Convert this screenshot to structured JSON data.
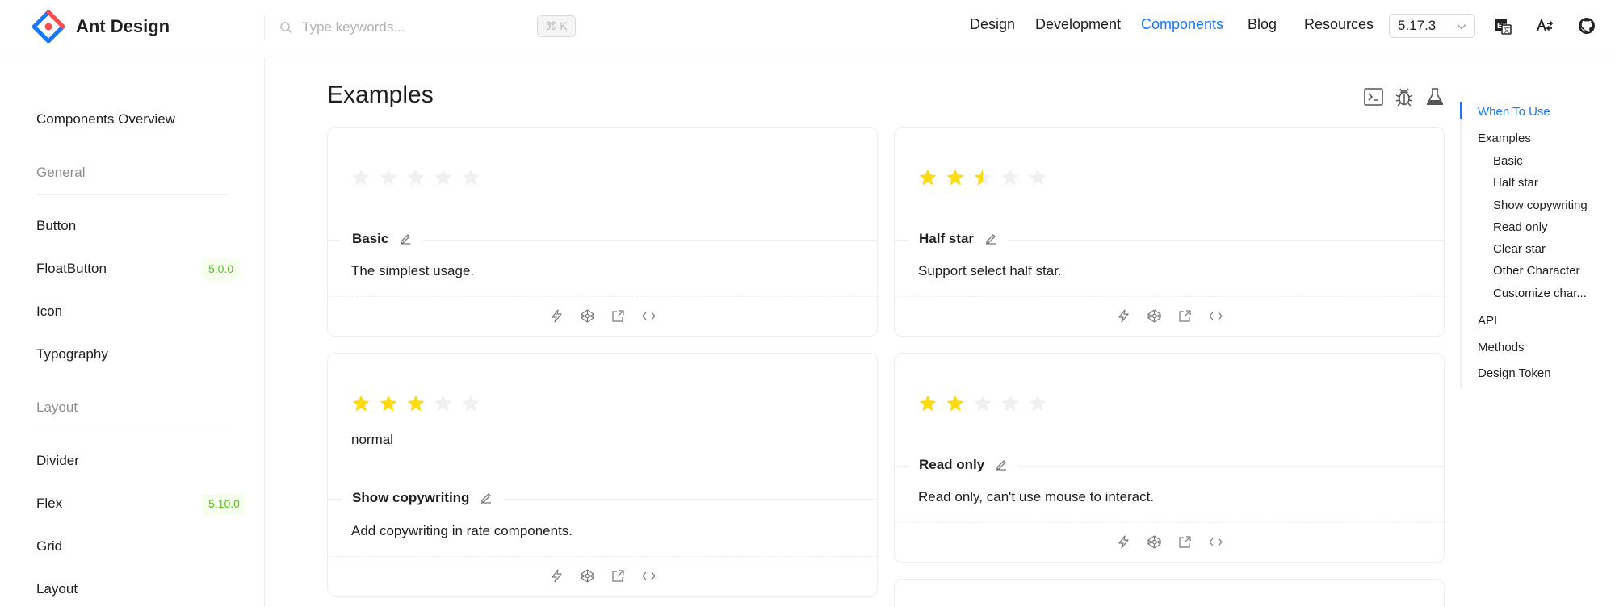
{
  "header": {
    "logo_text": "Ant Design",
    "search_placeholder": "Type keywords...",
    "search_shortcut": "⌘ K",
    "nav": [
      "Design",
      "Development",
      "Components",
      "Blog",
      "Resources"
    ],
    "active_nav": "Components",
    "version": "5.17.3",
    "icons": [
      "translate-icon",
      "text-direction-icon",
      "github-icon"
    ]
  },
  "sidebar": {
    "overview": "Components Overview",
    "groups": {
      "general": "General",
      "layout": "Layout"
    },
    "items": {
      "button": "Button",
      "floatbutton": "FloatButton",
      "floatbutton_badge": "5.0.0",
      "icon": "Icon",
      "typography": "Typography",
      "divider": "Divider",
      "flex": "Flex",
      "flex_badge": "5.10.0",
      "grid": "Grid",
      "layout": "Layout"
    }
  },
  "main": {
    "title": "Examples",
    "tool_icons": [
      "terminal-icon",
      "bug-icon",
      "experiment-icon"
    ],
    "cards": {
      "basic": {
        "title": "Basic",
        "desc": "The simplest usage.",
        "rating": 0
      },
      "half": {
        "title": "Half star",
        "desc": "Support select half star.",
        "rating": 2.5
      },
      "copy": {
        "title": "Show copywriting",
        "desc": "Add copywriting in rate components.",
        "rating": 3,
        "label": "normal"
      },
      "readonly": {
        "title": "Read only",
        "desc": "Read only, can't use mouse to interact.",
        "rating": 2
      }
    },
    "action_icons": [
      "thunderbolt-icon",
      "codepen-icon",
      "external-link-icon",
      "code-icon"
    ]
  },
  "toc": {
    "when": "When To Use",
    "examples": "Examples",
    "basic": "Basic",
    "half": "Half star",
    "copy": "Show copywriting",
    "readonly": "Read only",
    "clear": "Clear star",
    "other": "Other Character",
    "custom": "Customize char...",
    "api": "API",
    "methods": "Methods",
    "token": "Design Token"
  },
  "colors": {
    "accent": "#1677ff",
    "star_filled": "#fadb14",
    "star_empty": "#f0f0f0",
    "badge_green": "#52c41a"
  }
}
